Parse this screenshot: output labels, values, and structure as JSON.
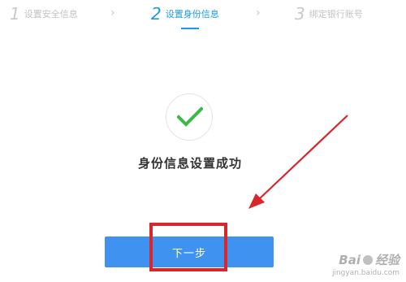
{
  "steps": [
    {
      "number": "1",
      "label": "设置安全信息",
      "active": false
    },
    {
      "number": "2",
      "label": "设置身份信息",
      "active": true
    },
    {
      "number": "3",
      "label": "绑定银行账号",
      "active": false
    }
  ],
  "step_separator": "›",
  "success": {
    "icon": "checkmark-icon",
    "message": "身份信息设置成功"
  },
  "next_button": {
    "label": "下一步"
  },
  "colors": {
    "accent": "#1a9bdb",
    "button": "#3f92ef",
    "check": "#3cb94a",
    "annotation": "#d9262a",
    "inactive": "#c2c2c2"
  },
  "watermark": {
    "brand": "Bai",
    "brand_suffix": "经验",
    "url": "jingyan.baidu.com"
  }
}
